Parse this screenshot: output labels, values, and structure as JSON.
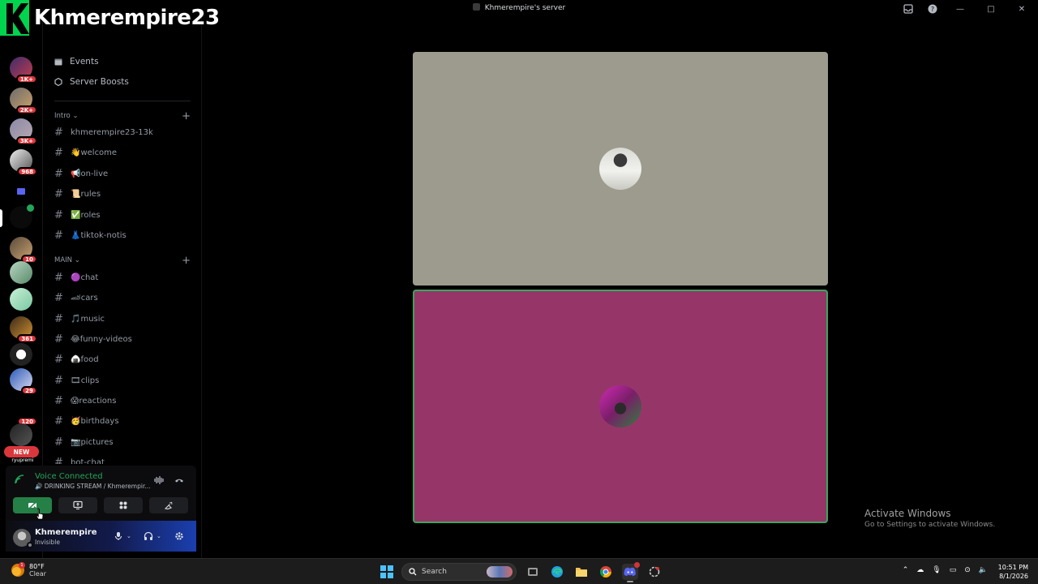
{
  "overlay": {
    "channel_name": "Khmerempire23"
  },
  "window": {
    "title": "Khmerempire's server"
  },
  "rail": {
    "badges": [
      "1K+",
      "2K+",
      "3K+",
      "968",
      "10",
      "361",
      "29",
      "120"
    ],
    "new_pill": "NEW",
    "last_server_label": "ryupremi"
  },
  "sidebar": {
    "nav": [
      {
        "label": "Events",
        "icon": "calendar-icon"
      },
      {
        "label": "Server Boosts",
        "icon": "boost-icon"
      }
    ],
    "categories": [
      {
        "name": "Intro",
        "channels": [
          {
            "name": "khmerempire23-13k",
            "emoji": ""
          },
          {
            "name": "welcome",
            "emoji": "👋"
          },
          {
            "name": "on-live",
            "emoji": "📢"
          },
          {
            "name": "rules",
            "emoji": "📜"
          },
          {
            "name": "roles",
            "emoji": "✅"
          },
          {
            "name": "tiktok-notis",
            "emoji": "👗"
          }
        ]
      },
      {
        "name": "MAIN",
        "channels": [
          {
            "name": "chat",
            "emoji": "🟣"
          },
          {
            "name": "cars",
            "emoji": "🏎"
          },
          {
            "name": "music",
            "emoji": "🎵"
          },
          {
            "name": "funny-videos",
            "emoji": "😂"
          },
          {
            "name": "food",
            "emoji": "🍙"
          },
          {
            "name": "clips",
            "emoji": "🎞"
          },
          {
            "name": "reactions",
            "emoji": "😱"
          },
          {
            "name": "birthdays",
            "emoji": "🥳"
          },
          {
            "name": "pictures",
            "emoji": "📷"
          },
          {
            "name": "bot-chat",
            "emoji": ""
          }
        ]
      }
    ]
  },
  "voice": {
    "title": "Voice Connected",
    "subtitle": "DRINKING STREAM / Khmerempir..."
  },
  "user": {
    "name": "Khmerempire",
    "status": "Invisible"
  },
  "watermark": {
    "line1": "Activate Windows",
    "line2": "Go to Settings to activate Windows."
  },
  "taskbar": {
    "weather_temp": "80°F",
    "weather_desc": "Clear",
    "weather_alert": "1",
    "search_label": "Search",
    "time": "10:51 PM",
    "date": "8/1/2026"
  },
  "colors": {
    "voice_green": "#23a55a",
    "tile_top": "#9c9b8d",
    "tile_bottom": "#963668",
    "speaking_border": "#3ba55d",
    "badge_red": "#da373c"
  }
}
